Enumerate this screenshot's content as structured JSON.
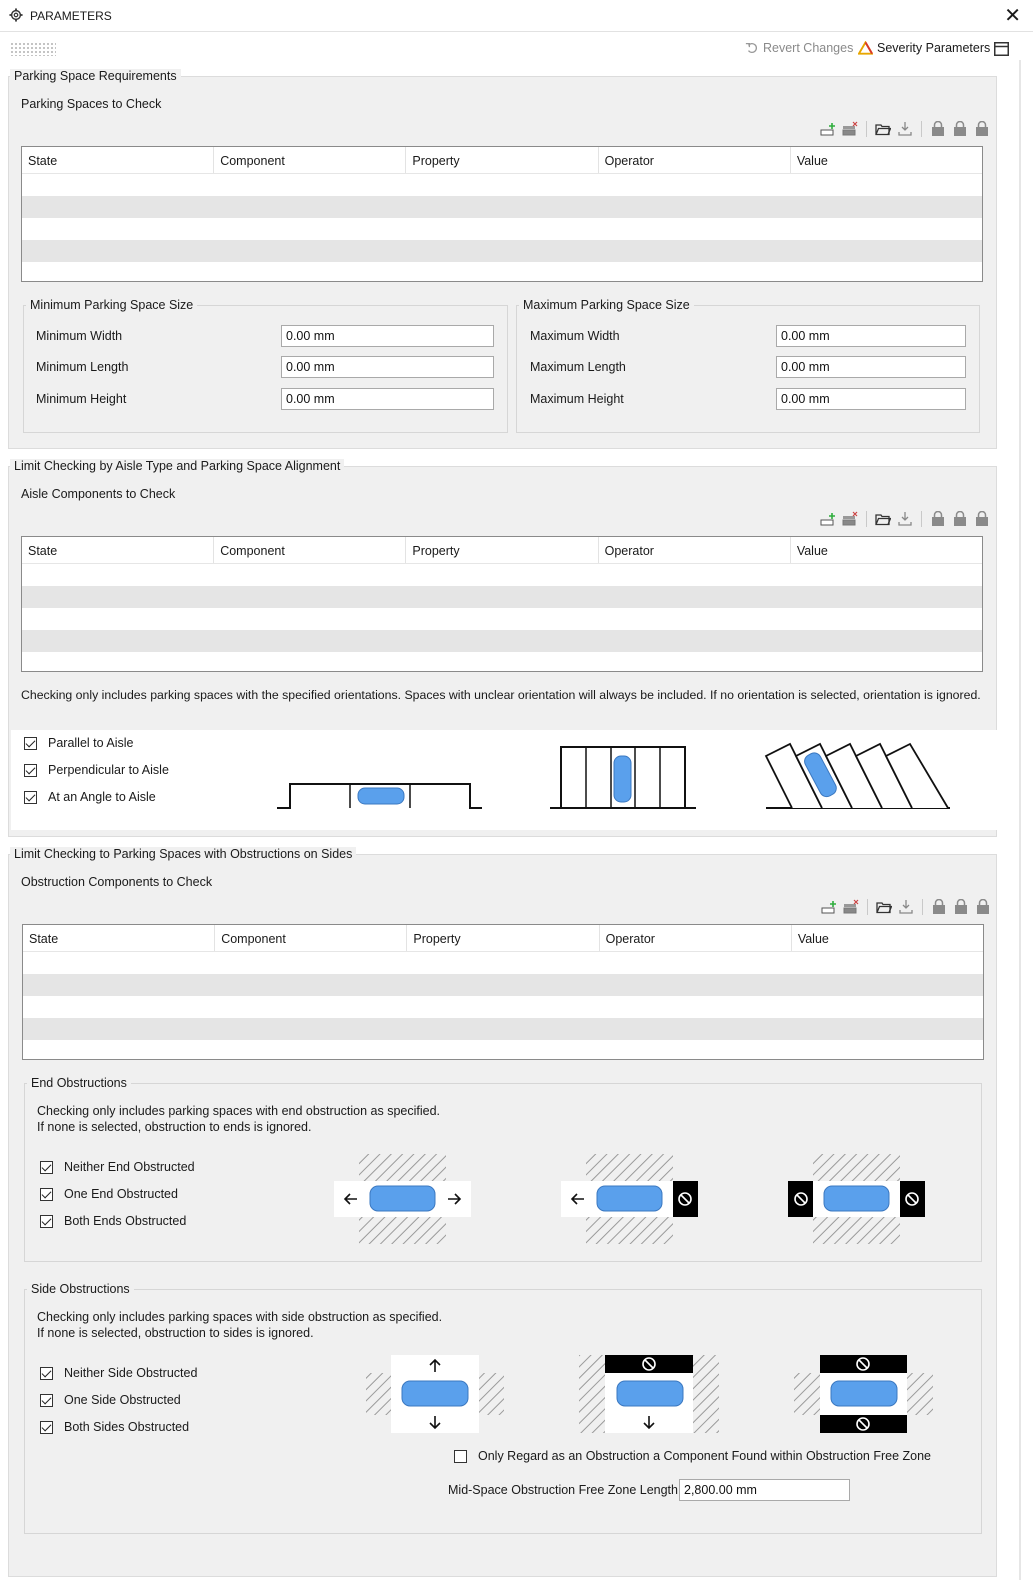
{
  "window": {
    "title": "PARAMETERS"
  },
  "toolbar": {
    "revert_label": "Revert Changes",
    "severity_label": "Severity Parameters"
  },
  "grid_columns": [
    "State",
    "Component",
    "Property",
    "Operator",
    "Value"
  ],
  "section1": {
    "title": "Parking Space Requirements",
    "grid_label": "Parking Spaces to Check",
    "min_group": {
      "title": "Minimum Parking Space Size",
      "fields": [
        {
          "label": "Minimum Width",
          "value": "0.00 mm"
        },
        {
          "label": "Minimum Length",
          "value": "0.00 mm"
        },
        {
          "label": "Minimum Height",
          "value": "0.00 mm"
        }
      ]
    },
    "max_group": {
      "title": "Maximum Parking Space Size",
      "fields": [
        {
          "label": "Maximum Width",
          "value": "0.00 mm"
        },
        {
          "label": "Maximum Length",
          "value": "0.00 mm"
        },
        {
          "label": "Maximum Height",
          "value": "0.00 mm"
        }
      ]
    }
  },
  "section2": {
    "title": "Limit Checking by Aisle Type and Parking Space Alignment",
    "grid_label": "Aisle Components to Check",
    "note": "Checking only includes parking spaces with the specified orientations. Spaces with unclear orientation will always be included. If no orientation is selected, orientation is ignored.",
    "checkboxes": [
      {
        "label": "Parallel to Aisle",
        "checked": true
      },
      {
        "label": "Perpendicular to Aisle",
        "checked": true
      },
      {
        "label": "At an Angle to Aisle",
        "checked": true
      }
    ]
  },
  "section3": {
    "title": "Limit Checking to Parking Spaces with Obstructions on Sides",
    "grid_label": "Obstruction Components to Check",
    "end_group": {
      "title": "End Obstructions",
      "note_line1": "Checking only includes parking spaces with end obstruction as specified.",
      "note_line2": "If none is selected, obstruction to ends is ignored.",
      "checkboxes": [
        {
          "label": "Neither End Obstructed",
          "checked": true
        },
        {
          "label": "One End Obstructed",
          "checked": true
        },
        {
          "label": "Both Ends Obstructed",
          "checked": true
        }
      ]
    },
    "side_group": {
      "title": "Side Obstructions",
      "note_line1": "Checking only includes parking spaces with side obstruction as specified.",
      "note_line2": "If none is selected, obstruction to sides is ignored.",
      "checkboxes": [
        {
          "label": "Neither Side Obstructed",
          "checked": true
        },
        {
          "label": "One Side Obstructed",
          "checked": true
        },
        {
          "label": "Both Sides Obstructed",
          "checked": true
        }
      ],
      "zone_checkbox": {
        "label": "Only Regard as an Obstruction a Component Found within Obstruction Free Zone",
        "checked": false
      },
      "zone_length": {
        "label": "Mid-Space Obstruction Free Zone Length",
        "value": "2,800.00 mm"
      }
    }
  },
  "colors": {
    "car": "#5aa0ec",
    "hatch": "#9a9a9a",
    "panel_bg": "#f0f0f0"
  },
  "icons": [
    "gear-icon",
    "close-icon",
    "revert-icon",
    "warning-triangle-icon",
    "window-icon",
    "add-row-icon",
    "delete-row-icon",
    "folder-open-icon",
    "download-icon",
    "lock-icon"
  ]
}
